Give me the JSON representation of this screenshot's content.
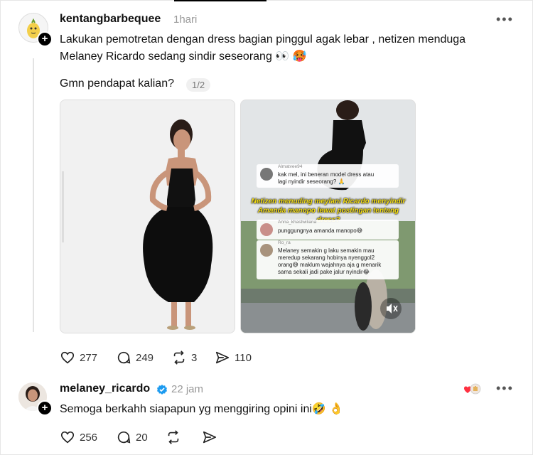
{
  "post": {
    "username": "kentangbarbequee",
    "time": "1hari",
    "more_label": "•••",
    "text_line1": "Lakukan pemotretan dengan dress bagian pinggul agak lebar , netizen menduga",
    "text_line2": "Melaney Ricardo sedang sindir seseorang 👀 🥵",
    "question": "Gmn pendapat kalian?",
    "pager": "1/2",
    "media": {
      "comments": [
        {
          "user": "Almatvee94",
          "text_line1": "kak mel, ini beneran model dress atau",
          "text_line2": "lagi nyindir seseorang? 🙏"
        },
        {
          "user": "Anna_khastwiliana",
          "text_line1": "punggungnya amanda manopo😅"
        },
        {
          "user": "Ro_ra",
          "text_line1": "Melaney semakin g laku semakin mau",
          "text_line2": "meredup sekarang hobinya nyenggol2",
          "text_line3": "orang😅 maklum wajahnya aja g menarik",
          "text_line4": "sama sekali jadi pake jalur nyindir😂"
        }
      ],
      "caption_line1": "Netizen menuding meylani Ricardo menyindir",
      "caption_line2": "Amanda manopo lewat postingan tentang dress?"
    },
    "actions": {
      "likes": "277",
      "comments": "249",
      "reposts": "3",
      "shares": "110"
    }
  },
  "reply": {
    "username": "melaney_ricardo",
    "time": "22 jam",
    "more_label": "•••",
    "text": "Semoga berkahh siapapun yg menggiring opini ini🤣 👌",
    "actions": {
      "likes": "256",
      "comments": "20"
    }
  },
  "icons": [
    "heart-icon",
    "comment-icon",
    "repost-icon",
    "share-icon",
    "verified-badge-icon",
    "mute-icon",
    "plus-icon"
  ]
}
